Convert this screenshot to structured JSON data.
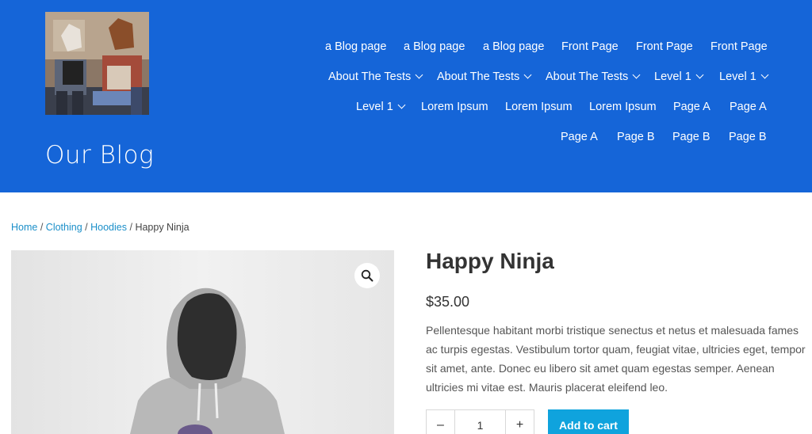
{
  "site": {
    "title": "Our Blog"
  },
  "nav": {
    "row1": [
      "a Blog page",
      "a Blog page",
      "a Blog page",
      "Front Page",
      "Front Page",
      "Front Page"
    ],
    "row2": [
      "About The Tests",
      "About The Tests",
      "About The Tests",
      "Level 1",
      "Level 1"
    ],
    "row3": [
      "Level 1",
      "Lorem Ipsum",
      "Lorem Ipsum",
      "Lorem Ipsum",
      "Page A",
      "Page A"
    ],
    "row4": [
      "Page A",
      "Page B",
      "Page B",
      "Page B"
    ]
  },
  "breadcrumb": {
    "home": "Home",
    "clothing": "Clothing",
    "hoodies": "Hoodies",
    "current": "Happy Ninja",
    "separator": "/"
  },
  "product": {
    "title": "Happy Ninja",
    "price": "$35.00",
    "description": "Pellentesque habitant morbi tristique senectus et netus et malesuada fames ac turpis egestas. Vestibulum tortor quam, feugiat vitae, ultricies eget, tempor sit amet, ante. Donec eu libero sit amet quam egestas semper. Aenean ultricies mi vitae est. Mauris placerat eleifend leo.",
    "quantity": "1",
    "minus_label": "–",
    "plus_label": "+",
    "add_to_cart_label": "Add to cart"
  },
  "icons": {
    "zoom": "search-icon",
    "dropdown": "chevron-down-icon"
  },
  "colors": {
    "header_bg": "#1565d8",
    "link": "#1b8fc9",
    "button": "#0fa3dd"
  }
}
